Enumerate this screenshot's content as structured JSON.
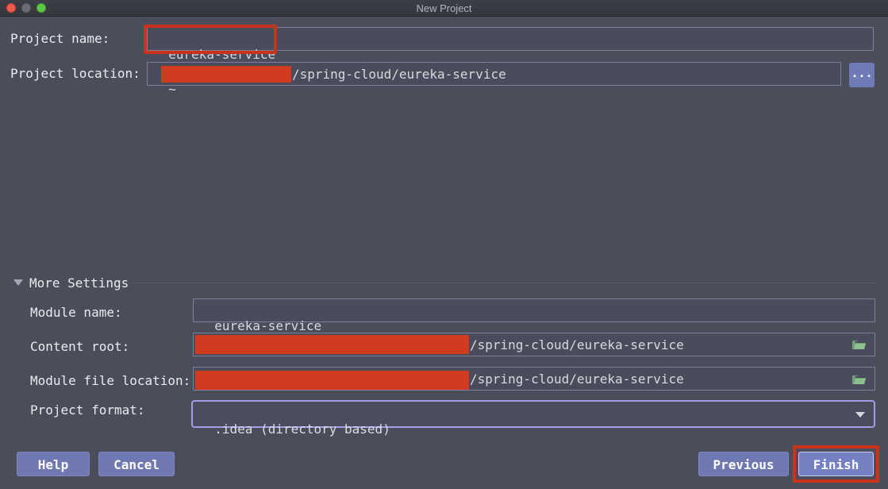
{
  "window": {
    "title": "New Project"
  },
  "project": {
    "name_label": "Project name:",
    "name_value": "eureka-service",
    "location_label": "Project location:",
    "location_prefix": "~",
    "location_suffix": "/spring-cloud/eureka-service",
    "browse_label": "..."
  },
  "more_settings": {
    "title": "More Settings",
    "module_name_label": "Module name:",
    "module_name_value": "eureka-service",
    "content_root_label": "Content root:",
    "content_root_suffix": "/spring-cloud/eureka-service",
    "module_file_label": "Module file location:",
    "module_file_suffix": "/spring-cloud/eureka-service",
    "format_label": "Project format:",
    "format_value": ".idea (directory based)"
  },
  "buttons": {
    "help": "Help",
    "cancel": "Cancel",
    "previous": "Previous",
    "finish": "Finish"
  },
  "colors": {
    "accent": "#6f78b0",
    "highlight": "#c9331c",
    "redaction": "#d13c20",
    "background": "#4b4d5b"
  },
  "icons": [
    "folder-icon",
    "chevron-down-icon",
    "caret-down-icon"
  ]
}
